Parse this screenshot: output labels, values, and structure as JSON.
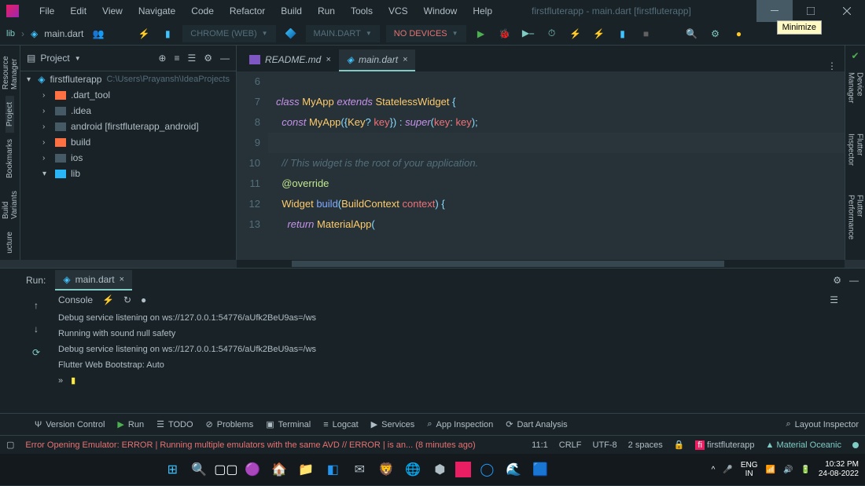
{
  "titlebar": {
    "menus": [
      "File",
      "Edit",
      "View",
      "Navigate",
      "Code",
      "Refactor",
      "Build",
      "Run",
      "Tools",
      "VCS",
      "Window",
      "Help"
    ],
    "title": "firstfluterapp - main.dart [firstfluterapp]",
    "tooltip": "Minimize"
  },
  "navbar": {
    "crumb_root": "lib",
    "crumb_file": "main.dart",
    "dropdown_device": "CHROME (WEB)",
    "dropdown_config": "MAIN.DART",
    "dropdown_target": "NO DEVICES"
  },
  "left_rail": {
    "items": [
      "Resource Manager",
      "Project",
      "Bookmarks",
      "Build Variants",
      "ucture"
    ]
  },
  "project": {
    "title": "Project",
    "root_name": "firstfluterapp",
    "root_path": "C:\\Users\\Prayansh\\IdeaProjects",
    "folders": [
      {
        "name": ".dart_tool",
        "color": "orange"
      },
      {
        "name": ".idea",
        "color": "dark"
      },
      {
        "name": "android [firstfluterapp_android]",
        "color": "dark"
      },
      {
        "name": "build",
        "color": "orange"
      },
      {
        "name": "ios",
        "color": "dark"
      },
      {
        "name": "lib",
        "color": "blue"
      }
    ]
  },
  "editor": {
    "tabs": [
      {
        "name": "README.md",
        "active": false
      },
      {
        "name": "main.dart",
        "active": true
      }
    ],
    "line_start": 6,
    "lines": [
      {
        "no": 6,
        "html": ""
      },
      {
        "no": 7,
        "html": "kw:class type:MyApp kw:extends type:StatelessWidget punct:{"
      },
      {
        "no": 8,
        "html": "  kw:const type:MyApp punct:({ type:Key punct:? param:key punct:}) punct:: kw:super punct:( param:key punct:: param:key punct:);"
      },
      {
        "no": 9,
        "html": ""
      },
      {
        "no": 10,
        "html": "  comment:// This widget is the root of your application."
      },
      {
        "no": 11,
        "html": "  annot:@override"
      },
      {
        "no": 12,
        "html": "  type:Widget func:build punct:( type:BuildContext param:context punct:) punct:{"
      },
      {
        "no": 13,
        "html": "    kw:return type:MaterialApp punct:("
      }
    ]
  },
  "run": {
    "label": "Run:",
    "tab": "main.dart",
    "console_title": "Console",
    "log_lines": [
      "Debug service listening on ws://127.0.0.1:54776/aUfk2BeU9as=/ws",
      "",
      " Running with sound null safety",
      "Debug service listening on ws://127.0.0.1:54776/aUfk2BeU9as=/ws",
      "Flutter Web Bootstrap: Auto"
    ]
  },
  "bottom_bar": {
    "items_left": [
      "Version Control",
      "Run",
      "TODO",
      "Problems",
      "Terminal",
      "Logcat",
      "Services",
      "App Inspection",
      "Dart Analysis"
    ],
    "items_right": [
      "Layout Inspector"
    ]
  },
  "status": {
    "error_msg": "Error Opening Emulator: ERROR   | Running multiple emulators with the same AVD // ERROR   | is an... (8 minutes ago)",
    "line_col": "11:1",
    "line_ending": "CRLF",
    "encoding": "UTF-8",
    "indent": "2 spaces",
    "project_name": "firstfluterapp",
    "theme": "Material Oceanic"
  },
  "right_rail": {
    "items": [
      "Device Manager",
      "Flutter Inspector",
      "Flutter Performance",
      ""
    ]
  },
  "taskbar": {
    "lang": "ENG",
    "region": "IN",
    "time": "10:32 PM",
    "date": "24-08-2022"
  }
}
